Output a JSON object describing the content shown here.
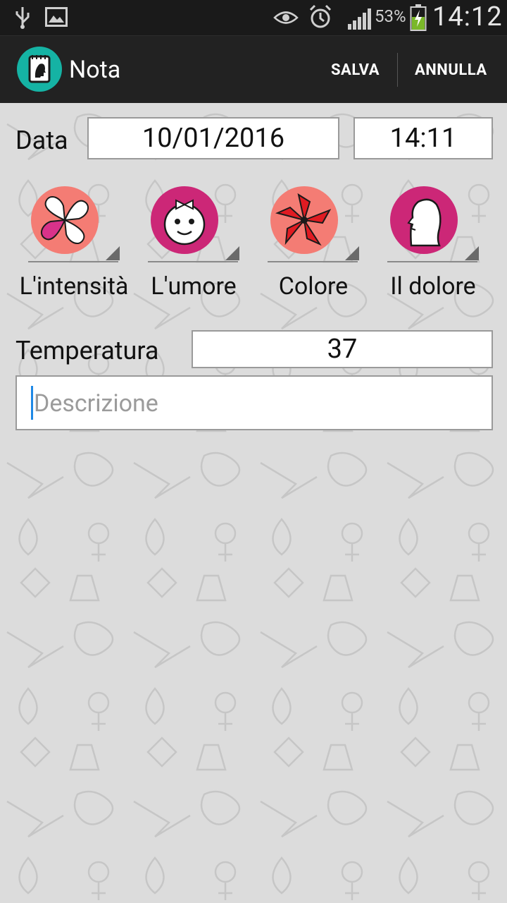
{
  "status_bar": {
    "battery_percent": "53%",
    "time": "14:12",
    "icons": [
      "usb-icon",
      "image-icon",
      "eye-icon",
      "alarm-icon",
      "signal-icon",
      "battery-charging-icon"
    ]
  },
  "action_bar": {
    "title": "Nota",
    "save_label": "SALVA",
    "cancel_label": "ANNULLA"
  },
  "form": {
    "date_label": "Data",
    "date_value": "10/01/2016",
    "time_value": "14:11",
    "categories": [
      {
        "label": "L'intensità",
        "icon": "clover-hearts-icon",
        "color": "#f47c74"
      },
      {
        "label": "L'umore",
        "icon": "girl-face-icon",
        "color": "#cc2777"
      },
      {
        "label": "Colore",
        "icon": "red-flower-icon",
        "color": "#f47c74"
      },
      {
        "label": "Il dolore",
        "icon": "head-profile-icon",
        "color": "#cc2777"
      }
    ],
    "temperature_label": "Temperatura",
    "temperature_value": "37",
    "description_placeholder": "Descrizione"
  }
}
